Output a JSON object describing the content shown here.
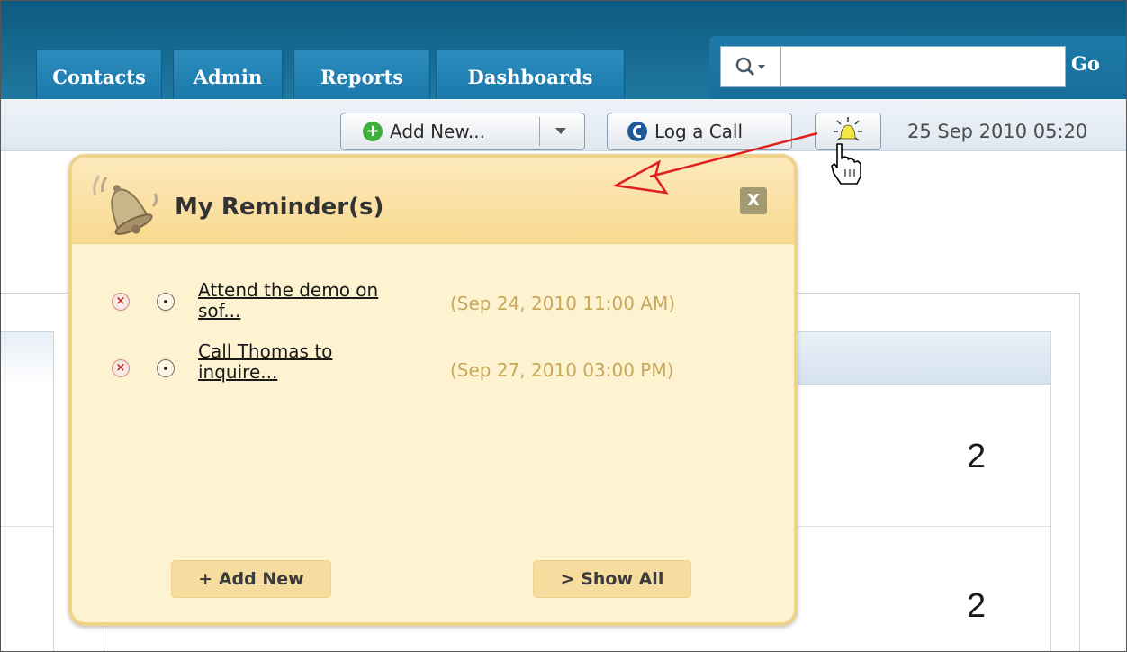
{
  "nav": {
    "tabs": [
      {
        "label": "Contacts"
      },
      {
        "label": "Admin"
      },
      {
        "label": "Reports"
      },
      {
        "label": "Dashboards"
      }
    ],
    "search_button": "Go"
  },
  "toolbar": {
    "add_new_label": "Add New...",
    "log_call_label": "Log a Call",
    "reminder_icon": "bell-alert-icon",
    "datetime": "25 Sep 2010 05:20"
  },
  "background": {
    "counts": [
      "2",
      "2"
    ]
  },
  "reminders_popup": {
    "title": "My Reminder(s)",
    "close_label": "X",
    "items": [
      {
        "title_line1": "Attend the demo on",
        "title_line2": "sof...",
        "datetime": "(Sep 24, 2010 11:00 AM)"
      },
      {
        "title_line1": "Call Thomas to",
        "title_line2": "inquire...",
        "datetime": "(Sep 27, 2010 03:00 PM)"
      }
    ],
    "add_new_label": "+ Add New",
    "show_all_label": "> Show All"
  },
  "colors": {
    "header": "#1a6f96",
    "popup_bg": "#fdf3d1",
    "popup_border": "#f0d38a",
    "annotation_arrow": "#e02020"
  }
}
